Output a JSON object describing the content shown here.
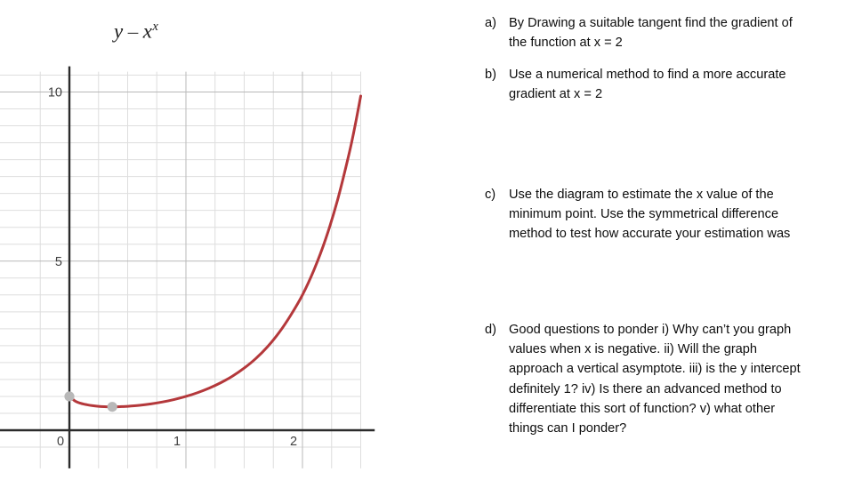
{
  "graph": {
    "title_lhs": "y",
    "title_eq": "–",
    "title_base": "x",
    "title_exp": "x",
    "title_plain": "y = x^x",
    "x_tick_labels": [
      "0",
      "1",
      "2"
    ],
    "y_tick_labels": [
      "0",
      "5",
      "10"
    ],
    "curve_color": "#B4383B",
    "point_color": "#B8B8B8",
    "axis_color": "#2b2b2b",
    "gridline_color": "#dedede",
    "major_gridline_color": "#b9b9b9"
  },
  "chart_data": {
    "type": "line",
    "title": "y = x^x",
    "xlabel": "",
    "ylabel": "",
    "xlim": [
      -0.4,
      2.5
    ],
    "ylim": [
      -0.55,
      10.6
    ],
    "xticks": [
      0,
      1,
      2
    ],
    "yticks": [
      0,
      5,
      10
    ],
    "grid": true,
    "minor_grid_x_step": 0.25,
    "minor_grid_y_step": 0.5,
    "legend": "none",
    "series": [
      {
        "name": "y = x^x",
        "color": "#B4383B",
        "x": [
          0.0,
          0.05,
          0.1,
          0.15,
          0.2,
          0.25,
          0.3,
          0.35,
          0.368,
          0.4,
          0.45,
          0.5,
          0.6,
          0.7,
          0.8,
          0.9,
          1.0,
          1.1,
          1.2,
          1.3,
          1.4,
          1.5,
          1.6,
          1.7,
          1.8,
          1.9,
          2.0,
          2.1,
          2.2,
          2.3,
          2.4,
          2.45,
          2.5
        ],
        "y": [
          1.0,
          0.861,
          0.794,
          0.754,
          0.725,
          0.707,
          0.697,
          0.693,
          0.6922,
          0.693,
          0.699,
          0.707,
          0.736,
          0.779,
          0.836,
          0.909,
          1.0,
          1.111,
          1.245,
          1.406,
          1.6,
          1.837,
          2.121,
          2.468,
          2.89,
          3.404,
          4.0,
          4.749,
          5.663,
          6.79,
          8.173,
          8.98,
          9.882
        ],
        "marker": "none",
        "linewidth": 3
      }
    ],
    "points": [
      {
        "label": "y-intercept",
        "x": 0.0,
        "y": 1.0,
        "color": "#B8B8B8"
      },
      {
        "label": "minimum",
        "x": 0.368,
        "y": 0.692,
        "color": "#B8B8B8"
      }
    ]
  },
  "questions": [
    {
      "marker": "a)",
      "text": "By Drawing a suitable tangent find the gradient of the function at x = 2"
    },
    {
      "marker": "b)",
      "text": "Use a numerical method to find a more accurate gradient at x = 2"
    },
    {
      "marker": "c)",
      "text": "Use the diagram to estimate the x value of the minimum point. Use the symmetrical difference method to test how accurate your estimation was"
    },
    {
      "marker": "d)",
      "text": "Good questions to ponder i) Why can’t you graph values when x is negative. ii) Will the graph approach a vertical asymptote. iii) is the y intercept definitely 1? iv) Is there an advanced method to differentiate this sort of function? v) what other things can I ponder?"
    }
  ]
}
